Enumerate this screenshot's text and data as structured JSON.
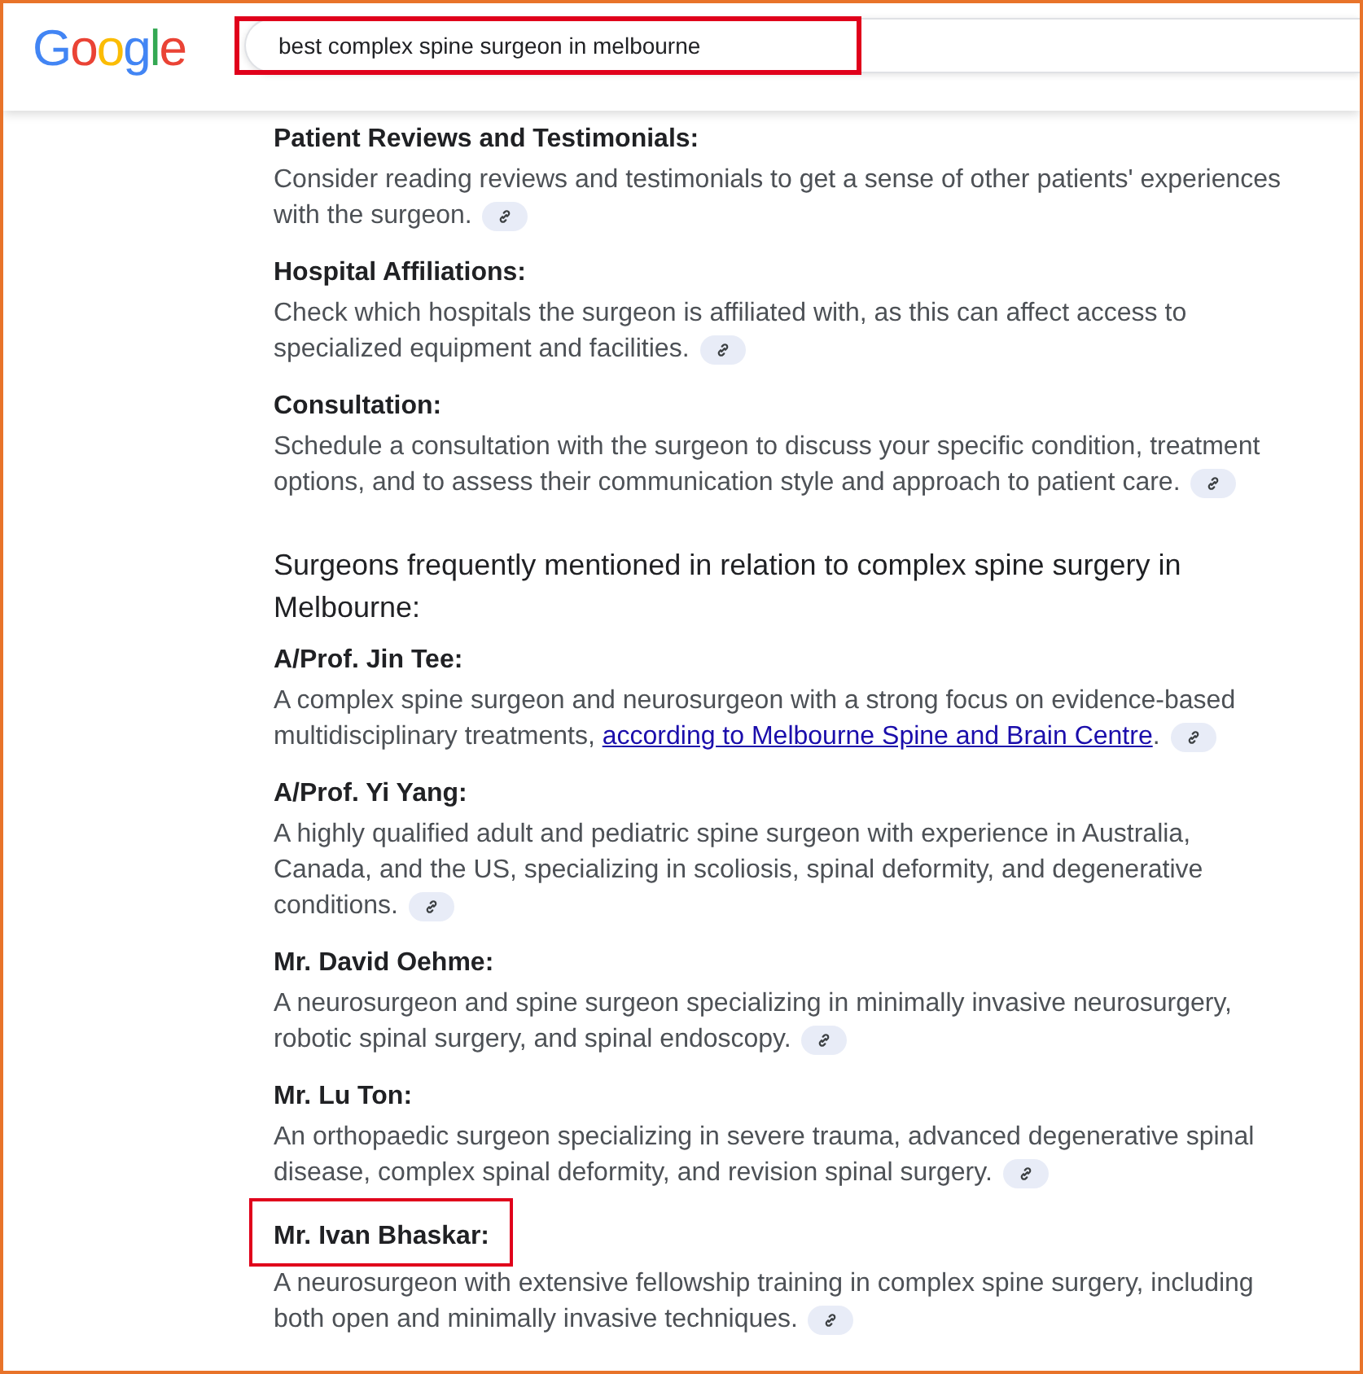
{
  "header": {
    "logo": "Google",
    "search": {
      "value": "best complex spine surgeon in melbourne",
      "highlighted": true
    }
  },
  "sections": [
    {
      "kind": "item",
      "heading": "Patient Reviews and Testimonials:",
      "highlighted": false,
      "text": "Consider reading reviews and testimonials to get a sense of other patients' experiences with the surgeon."
    },
    {
      "kind": "item",
      "heading": "Hospital Affiliations:",
      "highlighted": false,
      "text": "Check which hospitals the surgeon is affiliated with, as this can affect access to specialized equipment and facilities."
    },
    {
      "kind": "item",
      "heading": "Consultation:",
      "highlighted": false,
      "text": "Schedule a consultation with the surgeon to discuss your specific condition, treatment options, and to assess their communication style and approach to patient care."
    },
    {
      "kind": "title",
      "heading": "Surgeons frequently mentioned in relation to complex spine surgery in Melbourne:"
    },
    {
      "kind": "item",
      "heading": "A/Prof. Jin Tee:",
      "highlighted": false,
      "text": "A complex spine surgeon and neurosurgeon with a strong focus on evidence-based multidisciplinary treatments,",
      "link": "according to Melbourne Spine and Brain Centre",
      "after": "."
    },
    {
      "kind": "item",
      "heading": "A/Prof. Yi Yang:",
      "highlighted": false,
      "text": "A highly qualified adult and pediatric spine surgeon with experience in Australia, Canada, and the US, specializing in scoliosis, spinal deformity, and degenerative conditions."
    },
    {
      "kind": "item",
      "heading": "Mr. David Oehme:",
      "highlighted": false,
      "text": "A neurosurgeon and spine surgeon specializing in minimally invasive neurosurgery, robotic spinal surgery, and spinal endoscopy."
    },
    {
      "kind": "item",
      "heading": "Mr. Lu Ton:",
      "highlighted": false,
      "text": "An orthopaedic surgeon specializing in severe trauma, advanced degenerative spinal disease, complex spinal deformity, and revision spinal surgery."
    },
    {
      "kind": "item",
      "heading": "Mr. Ivan Bhaskar:",
      "highlighted": true,
      "text": "A neurosurgeon with extensive fellowship training in complex spine surgery, including both open and minimally invasive techniques."
    }
  ]
}
